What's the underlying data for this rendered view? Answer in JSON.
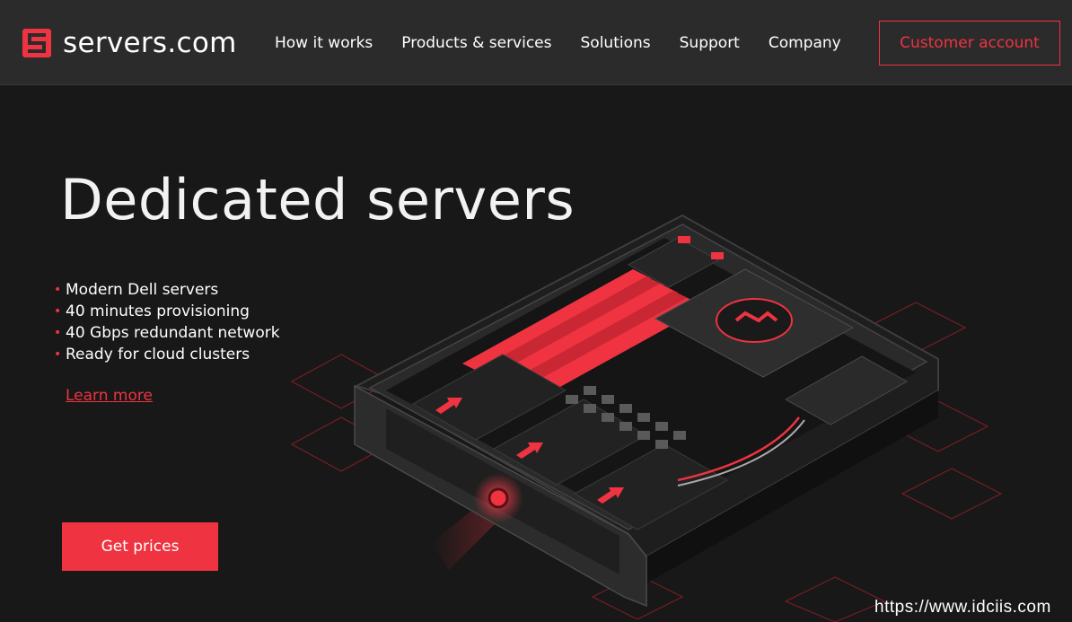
{
  "brand": {
    "name": "servers.com",
    "accent_color": "#ef3340"
  },
  "nav": {
    "items": [
      {
        "label": "How it works"
      },
      {
        "label": "Products & services"
      },
      {
        "label": "Solutions"
      },
      {
        "label": "Support"
      },
      {
        "label": "Company"
      }
    ],
    "account_label": "Customer account"
  },
  "hero": {
    "title": "Dedicated servers",
    "features": [
      "Modern Dell servers",
      "40 minutes provisioning",
      "40 Gbps redundant network",
      "Ready for cloud clusters"
    ],
    "learn_more": "Learn more",
    "cta_label": "Get prices",
    "illustration_icon": "server-illustration"
  },
  "watermark": "https://www.idciis.com"
}
